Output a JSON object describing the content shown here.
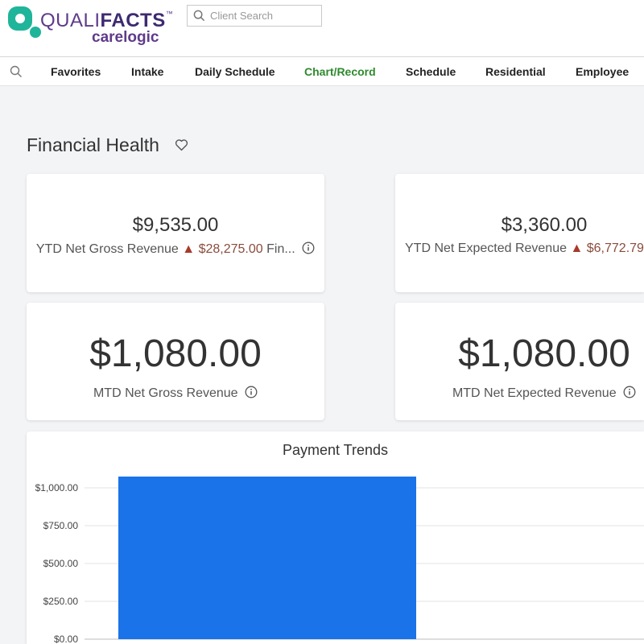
{
  "header": {
    "logo_light": "QUALI",
    "logo_bold": "FACTS",
    "logo_tm": "™",
    "logo_sub": "carelogic",
    "search_placeholder": "Client Search"
  },
  "nav": {
    "items": [
      "Favorites",
      "Intake",
      "Daily Schedule",
      "Chart/Record",
      "Schedule",
      "Residential",
      "Employee"
    ],
    "active": "Chart/Record"
  },
  "page": {
    "title": "Financial Health"
  },
  "cards": [
    {
      "value": "$9,535.00",
      "label": "YTD Net Gross Revenue",
      "arrow": "▲",
      "delta": "$28,275.00",
      "suffix": "Fin..."
    },
    {
      "value": "$3,360.00",
      "label": "YTD Net Expected Revenue",
      "arrow": "▲",
      "delta": "$6,772.79..."
    },
    {
      "value": "$1,080.00",
      "label": "MTD Net Gross Revenue"
    },
    {
      "value": "$1,080.00",
      "label": "MTD Net Expected Revenue"
    }
  ],
  "colors": {
    "brand_purple": "#5f3b8a",
    "brand_teal": "#1fb59a",
    "active_nav": "#2e8a2e",
    "bar": "#1a73e8",
    "delta": "#8a4c3c"
  },
  "chart_data": {
    "type": "bar",
    "title": "Payment Trends",
    "categories": [
      ""
    ],
    "values": [
      1080
    ],
    "ylim": [
      0,
      1000
    ],
    "y_ticks": [
      "$0.00",
      "$250.00",
      "$500.00",
      "$750.00",
      "$1,000.00"
    ],
    "grid": true
  }
}
